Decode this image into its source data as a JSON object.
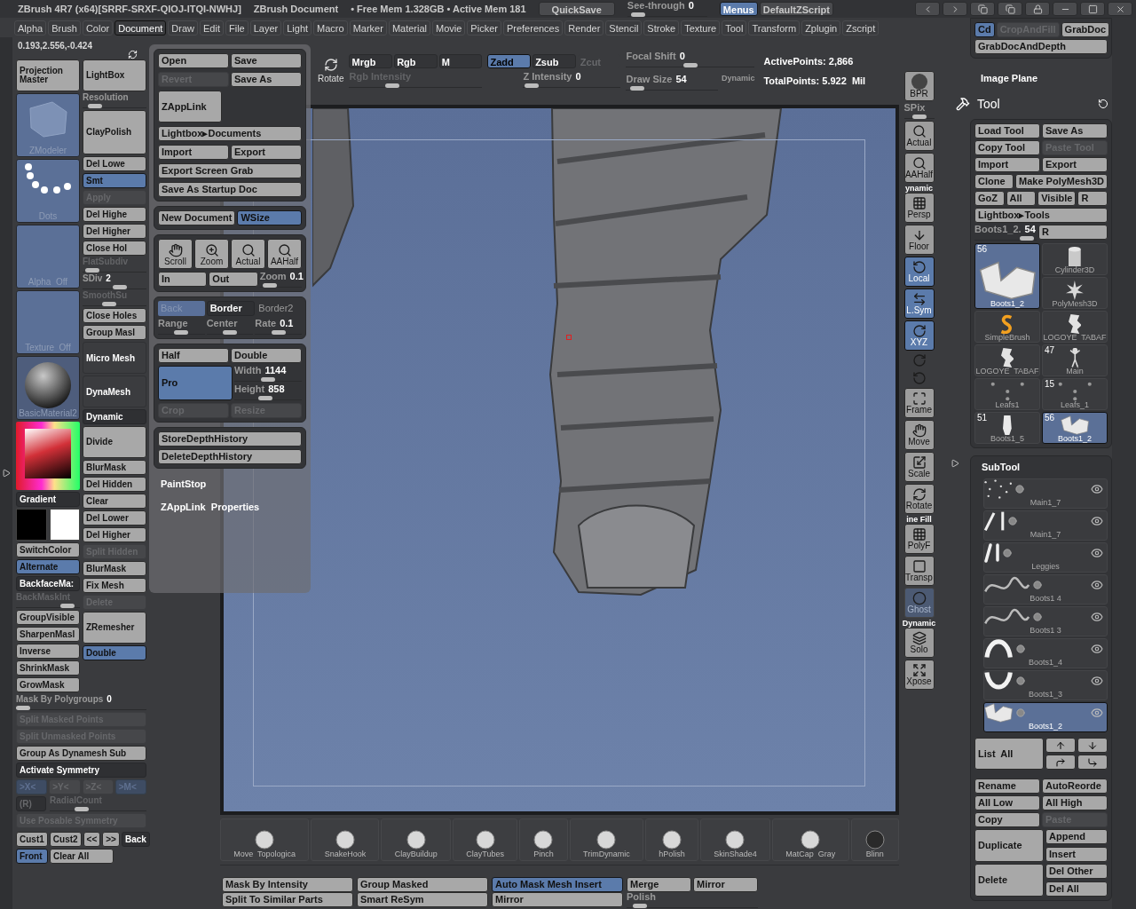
{
  "title_bar": {
    "title": "ZBrush 4R7 (x64)[SRRF-SRXF-QIOJ-ITQI-NWHJ]",
    "document": "ZBrush Document",
    "memory": "• Free Mem 1.328GB • Active Mem 181",
    "quicksave": "QuickSave",
    "see_through": {
      "label": "See-through",
      "value": "0",
      "level": 0.05
    },
    "menus": {
      "label": "Menus",
      "selected": true
    },
    "script": "DefaultZScript"
  },
  "menu_bar": [
    {
      "label": "Alpha",
      "selected": false
    },
    {
      "label": "Brush",
      "selected": false
    },
    {
      "label": "Color",
      "selected": false
    },
    {
      "label": "Document",
      "selected": true
    },
    {
      "label": "Draw",
      "selected": false
    },
    {
      "label": "Edit",
      "selected": false
    },
    {
      "label": "File",
      "selected": false
    },
    {
      "label": "Layer",
      "selected": false
    },
    {
      "label": "Light",
      "selected": false
    },
    {
      "label": "Macro",
      "selected": false
    },
    {
      "label": "Marker",
      "selected": false
    },
    {
      "label": "Material",
      "selected": false
    },
    {
      "label": "Movie",
      "selected": false
    },
    {
      "label": "Picker",
      "selected": false
    },
    {
      "label": "Preferences",
      "selected": false
    },
    {
      "label": "Render",
      "selected": false
    },
    {
      "label": "Stencil",
      "selected": false
    },
    {
      "label": "Stroke",
      "selected": false
    },
    {
      "label": "Texture",
      "selected": false
    },
    {
      "label": "Tool",
      "selected": false
    },
    {
      "label": "Transform",
      "selected": false
    },
    {
      "label": "Zplugin",
      "selected": false
    },
    {
      "label": "Zscript",
      "selected": false
    }
  ],
  "coordinates": "0.193,2.556,-0.424",
  "left_panel": {
    "col1": [
      {
        "kind": "big",
        "label": "Projection Master"
      },
      {
        "kind": "cube",
        "label": "ZModeler"
      },
      {
        "kind": "dots",
        "label": "Dots"
      },
      {
        "kind": "blank",
        "label": "Alpha  Off"
      },
      {
        "kind": "blank",
        "label": "Texture  Off"
      },
      {
        "kind": "sphere",
        "label": "BasicMaterial2"
      },
      {
        "kind": "picker"
      },
      {
        "kind": "dark",
        "label": "Gradient"
      },
      {
        "kind": "swatches"
      },
      {
        "kind": "button",
        "label": "SwitchColor"
      },
      {
        "kind": "button",
        "label": "Alternate",
        "selected": true
      },
      {
        "kind": "dark",
        "label": "BackfaceMa:"
      },
      {
        "kind": "slider",
        "label": "BackMaskInt",
        "disabled": true,
        "level": 0.9
      },
      {
        "kind": "button",
        "label": "GroupVisible"
      },
      {
        "kind": "button",
        "label": "SharpenMasl"
      },
      {
        "kind": "button",
        "label": "Inverse"
      },
      {
        "kind": "button",
        "label": "ShrinkMask"
      },
      {
        "kind": "button",
        "label": "GrowMask"
      }
    ],
    "col2": [
      {
        "kind": "big",
        "label": "LightBox"
      },
      {
        "kind": "slider",
        "label": "Resolution",
        "level": 0.1
      },
      {
        "kind": "tall",
        "label": "ClayPolish"
      },
      {
        "kind": "button",
        "label": "Del Lowe"
      },
      {
        "kind": "button",
        "label": "Smt",
        "selected": true
      },
      {
        "kind": "button",
        "label": "Apply",
        "disabled": true
      },
      {
        "kind": "button",
        "label": "Del Highe"
      },
      {
        "kind": "button",
        "label": "Del Higher"
      },
      {
        "kind": "button",
        "label": "Close Hol"
      },
      {
        "kind": "slider",
        "label": "FlatSubdiv",
        "disabled": true,
        "level": 0.05
      },
      {
        "kind": "slider",
        "label": "SDiv",
        "value": "2",
        "level": 0.6
      },
      {
        "kind": "slider",
        "label": "SmoothSu",
        "disabled": true,
        "level": 0.4
      },
      {
        "kind": "button",
        "label": "Close Holes"
      },
      {
        "kind": "button",
        "label": "Group Masl"
      },
      {
        "kind": "darkbig",
        "label": "Micro Mesh"
      },
      {
        "kind": "darkbig",
        "label": "DynaMesh"
      },
      {
        "kind": "dark",
        "label": "Dynamic"
      },
      {
        "kind": "big",
        "label": "Divide"
      },
      {
        "kind": "button",
        "label": "BlurMask"
      },
      {
        "kind": "button",
        "label": "Del Hidden"
      },
      {
        "kind": "button",
        "label": "Clear"
      },
      {
        "kind": "button",
        "label": "Del Lower"
      },
      {
        "kind": "button",
        "label": "Del Higher"
      },
      {
        "kind": "button",
        "label": "Split Hidden",
        "disabled": true
      },
      {
        "kind": "button",
        "label": "BlurMask"
      },
      {
        "kind": "button",
        "label": "Fix Mesh"
      },
      {
        "kind": "button",
        "label": "Delete",
        "disabled": true
      },
      {
        "kind": "big",
        "label": "ZRemesher"
      },
      {
        "kind": "button",
        "label": "Double",
        "selected": true
      }
    ],
    "rows": [
      [
        {
          "kind": "slider",
          "label": "Mask By Polygroups",
          "value": "0",
          "level": 0
        }
      ],
      [
        {
          "kind": "button",
          "label": "Split Masked Points",
          "disabled": true
        }
      ],
      [
        {
          "kind": "button",
          "label": "Split Unmasked Points",
          "disabled": true
        }
      ],
      [
        {
          "kind": "button",
          "label": "Group As Dynamesh Sub"
        }
      ],
      [
        {
          "kind": "dark",
          "label": "Activate Symmetry"
        }
      ]
    ],
    "symmetry_axes": [
      {
        "kind": "button",
        "label": ">X<",
        "selected": true,
        "disabled": true
      },
      {
        "kind": "button",
        "label": ">Y<",
        "disabled": true
      },
      {
        "kind": "button",
        "label": ">Z<",
        "disabled": true
      },
      {
        "kind": "button",
        "label": ">M<",
        "selected": true,
        "disabled": true
      }
    ],
    "radial": [
      {
        "kind": "dark",
        "label": "(R)",
        "disabled": true
      },
      {
        "kind": "slider",
        "label": "RadialCount",
        "disabled": true,
        "level": 0.3
      }
    ],
    "posable": {
      "kind": "button",
      "label": "Use Posable Symmetry",
      "disabled": true
    },
    "views": [
      {
        "kind": "button",
        "label": "Cust1"
      },
      {
        "kind": "button",
        "label": "Cust2"
      },
      {
        "kind": "button",
        "label": "<<"
      },
      {
        "kind": "button",
        "label": ">>"
      },
      {
        "kind": "dark",
        "label": "Back"
      }
    ],
    "view_actions": [
      {
        "kind": "button",
        "label": "Front",
        "selected": true
      },
      {
        "kind": "button",
        "label": "Clear  All"
      }
    ]
  },
  "document_menu": {
    "groups": [
      [
        [
          {
            "kind": "button",
            "label": "Open"
          },
          {
            "kind": "button",
            "label": "Save"
          }
        ],
        [
          {
            "kind": "button",
            "label": "Revert",
            "disabled": true
          },
          {
            "kind": "button",
            "label": "Save  As"
          }
        ],
        [
          {
            "kind": "big",
            "label": "ZAppLink"
          }
        ],
        [
          {
            "kind": "button",
            "label": "Lightbox▸Documents"
          }
        ],
        [
          {
            "kind": "button",
            "label": "Import"
          },
          {
            "kind": "button",
            "label": "Export"
          }
        ],
        [
          {
            "kind": "button",
            "label": "Export  Screen  Grab"
          }
        ],
        [
          {
            "kind": "button",
            "label": "Save  As  Startup  Doc"
          }
        ]
      ],
      [
        [
          {
            "kind": "button",
            "label": "New  Document"
          },
          {
            "kind": "button",
            "label": "WSize",
            "selected": true
          }
        ]
      ],
      [
        [
          {
            "kind": "hand",
            "label": "Scroll"
          },
          {
            "kind": "zoom",
            "label": "Zoom"
          },
          {
            "kind": "actual",
            "label": "Actual"
          },
          {
            "kind": "aahalf",
            "label": "AAHalf"
          }
        ],
        [
          {
            "kind": "button",
            "label": "In"
          },
          {
            "kind": "button",
            "label": "Out"
          },
          {
            "kind": "slider",
            "label": "Zoom",
            "value": "0.1",
            "level": 0.1
          }
        ]
      ],
      [
        [
          {
            "kind": "field",
            "label": "Back"
          },
          {
            "kind": "dark",
            "label": "Border"
          },
          {
            "kind": "flat",
            "label": "Border2"
          }
        ],
        [
          {
            "kind": "slider",
            "label": "Range",
            "level": 0.5
          },
          {
            "kind": "slider",
            "label": "Center",
            "level": 0.5
          },
          {
            "kind": "slider",
            "label": "Rate",
            "value": "0.1",
            "level": 0.5
          }
        ]
      ],
      [
        [
          {
            "kind": "button",
            "label": "Half"
          },
          {
            "kind": "button",
            "label": "Double"
          }
        ],
        [
          {
            "kind": "big",
            "label": "Pro",
            "selected": true
          },
          {
            "kind": "stack",
            "items": [
              {
                "kind": "slider",
                "label": "Width",
                "value": "1144",
                "level": 0.5
              },
              {
                "kind": "slider",
                "label": "Height",
                "value": "858",
                "level": 0.45
              }
            ]
          }
        ],
        [
          {
            "kind": "button",
            "label": "Crop",
            "disabled": true
          },
          {
            "kind": "button",
            "label": "Resize",
            "disabled": true
          }
        ]
      ],
      [
        [
          {
            "kind": "button",
            "label": "StoreDepthHistory"
          }
        ],
        [
          {
            "kind": "button",
            "label": "DeleteDepthHistory"
          }
        ]
      ]
    ],
    "notes": [
      "PaintStop",
      "ZAppLink  Properties"
    ]
  },
  "top_shelf": {
    "rotate": "Rotate",
    "color_modes": [
      {
        "label": "Mrgb",
        "selected": false
      },
      {
        "label": "Rgb",
        "selected": false
      },
      {
        "label": "M",
        "selected": false
      }
    ],
    "rgb_intensity": {
      "label": "Rgb  Intensity",
      "disabled": true,
      "level": 0.3
    },
    "depth_modes": [
      {
        "label": "Zadd",
        "selected": true
      },
      {
        "label": "Zsub",
        "selected": false
      },
      {
        "label": "Zcut",
        "selected": false,
        "disabled": true
      }
    ],
    "z_intensity": {
      "label": "Z  Intensity",
      "value": "0",
      "level": 0.02
    },
    "focal_shift": {
      "label": "Focal  Shift",
      "value": "0",
      "level": 0.5
    },
    "draw_size": {
      "label": "Draw  Size",
      "value": "54",
      "level": 0.05
    },
    "dynamic": "Dynamic",
    "stats": [
      "ActivePoints: 2,866",
      "TotalPoints: 5.922  Mil"
    ]
  },
  "right_shelf": [
    {
      "kind": "bpr",
      "label": "BPR"
    },
    {
      "kind": "spix",
      "label": "SPix",
      "level": 0.5
    },
    {
      "kind": "actual",
      "label": "Actual"
    },
    {
      "kind": "aahalf",
      "label": "AAHalf"
    },
    {
      "kind": "persp",
      "label": "Persp",
      "note": "ynamic"
    },
    {
      "kind": "floor",
      "label": "Floor"
    },
    {
      "kind": "local",
      "label": "Local",
      "selected": true
    },
    {
      "kind": "lsym",
      "label": "L.Sym",
      "selected": true
    },
    {
      "kind": "xyz",
      "label": "XYZ",
      "selected": true
    },
    {
      "kind": "roty"
    },
    {
      "kind": "rotz"
    },
    {
      "kind": "frame",
      "label": "Frame"
    },
    {
      "kind": "move",
      "label": "Move"
    },
    {
      "kind": "scale",
      "label": "Scale"
    },
    {
      "kind": "rotate",
      "label": "Rotate"
    },
    {
      "kind": "polyf",
      "label": "PolyF",
      "note": "ine Fill"
    },
    {
      "kind": "transp",
      "label": "Transp"
    },
    {
      "kind": "ghost",
      "label": "Ghost",
      "disabled": true
    },
    {
      "kind": "solo",
      "label": "Solo",
      "note": "Dynamic"
    },
    {
      "kind": "xpose",
      "label": "Xpose"
    }
  ],
  "brushes": [
    "Move  Topologica",
    "SnakeHook",
    "ClayBuildup",
    "ClayTubes",
    "Pinch",
    "TrimDynamic",
    "hPolish",
    "SkinShade4",
    "MatCap  Gray",
    "Blinn"
  ],
  "bottom_shelf": [
    [
      [
        {
          "kind": "button",
          "label": "Mask  By  Intensity"
        }
      ],
      [
        {
          "kind": "button",
          "label": "Split  To  Similar  Parts"
        }
      ]
    ],
    [
      [
        {
          "kind": "button",
          "label": "Group  Masked"
        }
      ],
      [
        {
          "kind": "button",
          "label": "Smart  ReSym"
        }
      ]
    ],
    [
      [
        {
          "kind": "button",
          "label": "Auto  Mask  Mesh  Insert",
          "selected": true
        }
      ],
      [
        {
          "kind": "button",
          "label": "Mirror"
        }
      ]
    ],
    [
      [
        {
          "kind": "button",
          "label": "Merge"
        },
        {
          "kind": "button",
          "label": "Mirror"
        }
      ],
      [
        {
          "kind": "slider",
          "label": "Polish",
          "level": 0.05
        }
      ]
    ]
  ],
  "right_panel": {
    "popup": [
      [
        {
          "kind": "button",
          "label": "Cd",
          "selected": true
        },
        {
          "kind": "button",
          "label": "CropAndFill",
          "disabled": true
        },
        {
          "kind": "button",
          "label": "GrabDoc"
        }
      ],
      [
        {
          "kind": "button",
          "label": "GrabDocAndDepth"
        }
      ]
    ],
    "image_plane": "Image Plane",
    "tool_title": "Tool",
    "tool_buttons": [
      [
        {
          "kind": "button",
          "label": "Load  Tool"
        },
        {
          "kind": "button",
          "label": "Save  As"
        }
      ],
      [
        {
          "kind": "button",
          "label": "Copy  Tool"
        },
        {
          "kind": "button",
          "label": "Paste  Tool",
          "disabled": true
        }
      ],
      [
        {
          "kind": "button",
          "label": "Import"
        },
        {
          "kind": "button",
          "label": "Export"
        }
      ],
      [
        {
          "kind": "button",
          "label": "Clone"
        },
        {
          "kind": "button",
          "label": "Make  PolyMesh3D"
        }
      ],
      [
        {
          "kind": "button",
          "label": "GoZ"
        },
        {
          "kind": "button",
          "label": "All"
        },
        {
          "kind": "button",
          "label": "Visible"
        },
        {
          "kind": "button",
          "label": "R"
        }
      ],
      [
        {
          "kind": "button",
          "label": "Lightbox▸Tools"
        }
      ],
      [
        {
          "kind": "slider",
          "label": "Boots1_2.",
          "value": "54",
          "level": 0.95
        },
        {
          "kind": "button",
          "label": "R"
        }
      ]
    ],
    "tools": [
      {
        "kind": "boot",
        "name": "Boots1_2",
        "count": "56",
        "selected": true,
        "large": true
      },
      {
        "kind": "cylinder",
        "name": "Cylinder3D",
        "selected": false
      },
      {
        "kind": "star",
        "name": "PolyMesh3D",
        "selected": false
      },
      {
        "kind": "brush",
        "name": "SimpleBrush",
        "selected": false
      },
      {
        "kind": "logo",
        "name": "LOGOYE  TABAF",
        "selected": false
      },
      {
        "kind": "logo",
        "name": "LOGOYE  TABAF",
        "selected": false
      },
      {
        "kind": "figure",
        "name": "Main",
        "count": "47",
        "selected": false
      },
      {
        "kind": "leaf",
        "name": "Leafs1",
        "selected": false
      },
      {
        "kind": "leaf",
        "name": "Leafs_1",
        "count": "15",
        "selected": false
      },
      {
        "kind": "bust",
        "name": "Boots1_5",
        "count": "51",
        "selected": false
      },
      {
        "kind": "boot",
        "name": "Boots1_2",
        "count": "56",
        "selected": true
      }
    ],
    "subtool_title": "SubTool",
    "subtools": [
      {
        "kind": "dots",
        "name": "Main1_7",
        "selected": false
      },
      {
        "kind": "strands",
        "name": "Main1_7",
        "selected": false
      },
      {
        "kind": "legs",
        "name": "Leggies",
        "selected": false
      },
      {
        "kind": "scribble",
        "name": "Boots1 4",
        "selected": false
      },
      {
        "kind": "scribble",
        "name": "Boots1 3",
        "selected": false
      },
      {
        "kind": "arc",
        "name": "Boots1_4",
        "selected": false
      },
      {
        "kind": "cup",
        "name": "Boots1_3",
        "selected": false
      },
      {
        "kind": "boot",
        "name": "Boots1_2",
        "selected": true
      }
    ],
    "list_all": "List  All",
    "subtool_buttons": [
      [
        {
          "kind": "button",
          "label": "Rename"
        },
        {
          "kind": "button",
          "label": "AutoReorde"
        }
      ],
      [
        {
          "kind": "button",
          "label": "All  Low"
        },
        {
          "kind": "button",
          "label": "All  High"
        }
      ],
      [
        {
          "kind": "button",
          "label": "Copy"
        },
        {
          "kind": "button",
          "label": "Paste",
          "disabled": true
        }
      ],
      [
        {
          "kind": "big",
          "label": "Duplicate"
        },
        {
          "kind": "stack",
          "items": [
            {
              "kind": "button",
              "label": "Append"
            },
            {
              "kind": "button",
              "label": "Insert"
            }
          ]
        }
      ],
      [
        {
          "kind": "big",
          "label": "Delete"
        },
        {
          "kind": "stack",
          "items": [
            {
              "kind": "button",
              "label": "Del  Other"
            },
            {
              "kind": "button",
              "label": "Del  All"
            }
          ]
        }
      ]
    ]
  }
}
